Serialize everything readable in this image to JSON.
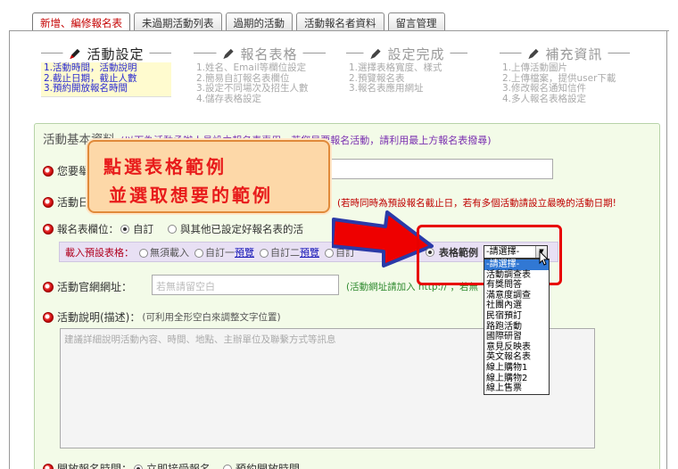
{
  "tabs": [
    {
      "label": "新增、編修報名表",
      "active": true
    },
    {
      "label": "未過期活動列表",
      "active": false
    },
    {
      "label": "過期的活動",
      "active": false
    },
    {
      "label": "活動報名者資料",
      "active": false
    },
    {
      "label": "留言管理",
      "active": false
    }
  ],
  "steps": [
    {
      "title": "活動設定",
      "active": true,
      "items": [
        "1.活動時間，活動說明",
        "2.截止日期，截止人數",
        "3.預約開放報名時間"
      ]
    },
    {
      "title": "報名表格",
      "active": false,
      "items": [
        "1.姓名、Email等欄位設定",
        "2.簡易自訂報名表欄位",
        "3.設定不同場次及招生人數",
        "4.儲存表格設定"
      ]
    },
    {
      "title": "設定完成",
      "active": false,
      "items": [
        "1.選擇表格寬度、樣式",
        "2.預覽報名表",
        "3.報名表應用網址"
      ]
    },
    {
      "title": "補充資訊",
      "active": false,
      "items": [
        "1.上傳活動圖片",
        "2.上傳檔案，提供user下載",
        "3.修改報名通知信件",
        "4.多人報名表格設定"
      ]
    }
  ],
  "panel": {
    "title": "活動基本資料",
    "subtitle": "(以下為活動承辦人員設立報名表專用，若您是要報名活動，請利用最上方報名表撥尋)"
  },
  "fields": {
    "name_label": "您要舉辦",
    "date_label": "活動日",
    "date_hint": "(若時同時為預設報名截止日，若有多個活動請設立最晚的活動日期!",
    "form_label": "報名表欄位：",
    "form_opt_custom": "自訂",
    "form_opt_other": "與其他已設定好報名表的活",
    "url_label": "活動官網網址：",
    "url_placeholder": "若無請留空白",
    "url_hint": "(活動網址請加入 http:// ，若無",
    "desc_label": "活動說明(描述)：",
    "desc_hint": "(可利用全形空白來調整文字位置)",
    "desc_placeholder": "建議詳細說明活動內容、時間、地點、主辦單位及聯繫方式等訊息",
    "open_label": "開放報名時間：",
    "open_opt1": "立即接受報名",
    "open_opt2": "預約開放時間"
  },
  "preset": {
    "label": "載入預設表格：",
    "opt_none": "無須載入",
    "opt_custom1": "自訂一",
    "opt_custom2": "自訂二",
    "opt_custom3": "自訂",
    "preview": "預覽",
    "sample_label": "表格範例"
  },
  "select": {
    "value": "-請選擇-",
    "options": [
      "-請選擇-",
      "活動調查表",
      "有獎問答",
      "滿意度調查",
      "社團內選",
      "民宿預訂",
      "路跑活動",
      "國際研習",
      "意見反映表",
      "英文報名表",
      "線上購物1",
      "線上購物2",
      "線上售票"
    ],
    "selected_index": 0
  },
  "callout": {
    "line1": "點選表格範例",
    "line2": "並選取想要的範例"
  },
  "colors": {
    "accent_red": "#e80000",
    "panel_bg": "#f3fbe8",
    "active_step_bg": "#fffbcf",
    "arrow_red": "#ee0000",
    "arrow_blue": "#2a3aa8"
  }
}
